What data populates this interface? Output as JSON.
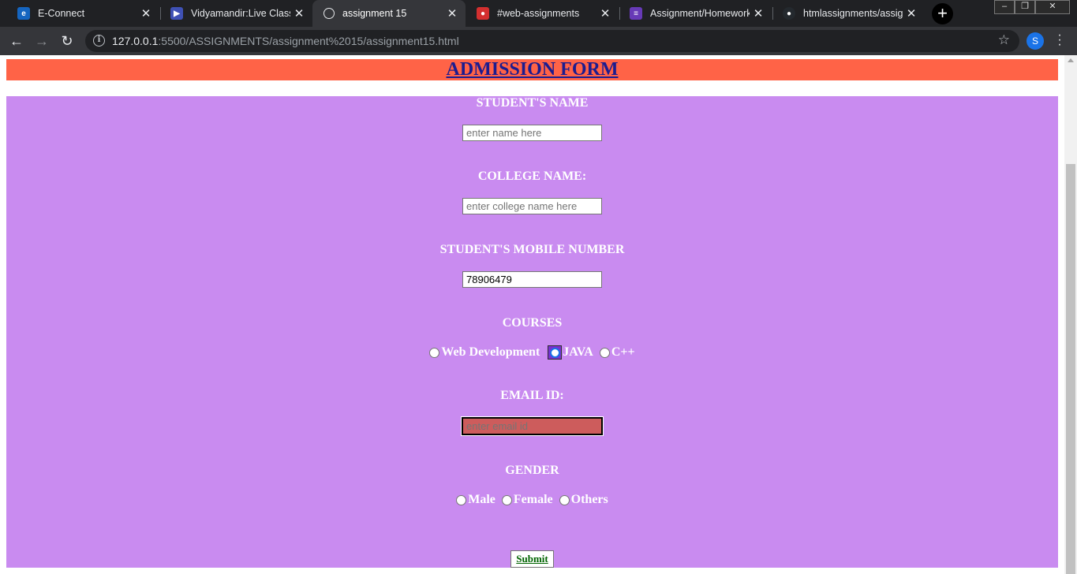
{
  "browser": {
    "tabs": [
      {
        "title": "E-Connect",
        "icon": "econnect-icon",
        "color": "#1565c0"
      },
      {
        "title": "Vidyamandir:Live Class",
        "icon": "live-class-icon",
        "color": "#3f51b5"
      },
      {
        "title": "assignment 15",
        "icon": "globe-icon",
        "active": true
      },
      {
        "title": "#web-assignments",
        "icon": "chat-icon",
        "color": "#d32f2f"
      },
      {
        "title": "Assignment/Homework",
        "icon": "list-icon",
        "color": "#673ab7"
      },
      {
        "title": "htmlassignments/assign",
        "icon": "github-icon",
        "color": "#24292e"
      }
    ],
    "new_tab_label": "+",
    "address": {
      "host": "127.0.0.1",
      "rest": ":5500/ASSIGNMENTS/assignment%2015/assignment15.html"
    },
    "profile_initial": "S"
  },
  "page": {
    "title": "ADMISSION FORM",
    "header_color": "#ff6347",
    "form_color": "#c98bf0",
    "fields": {
      "student_name": {
        "label": "STUDENT'S NAME",
        "placeholder": "enter name here",
        "value": ""
      },
      "college_name": {
        "label": "COLLEGE NAME:",
        "placeholder": "enter college name here",
        "value": ""
      },
      "mobile": {
        "label": "STUDENT'S MOBILE NUMBER",
        "placeholder": "",
        "value": "78906479"
      },
      "email": {
        "label": "EMAIL ID:",
        "placeholder": "enter email id",
        "value": ""
      }
    },
    "courses": {
      "label": "COURSES",
      "options": [
        "Web Development",
        "JAVA",
        "C++"
      ],
      "focused": "JAVA"
    },
    "gender": {
      "label": "GENDER",
      "options": [
        "Male",
        "Female",
        "Others"
      ]
    },
    "submit_label": "Submit"
  }
}
